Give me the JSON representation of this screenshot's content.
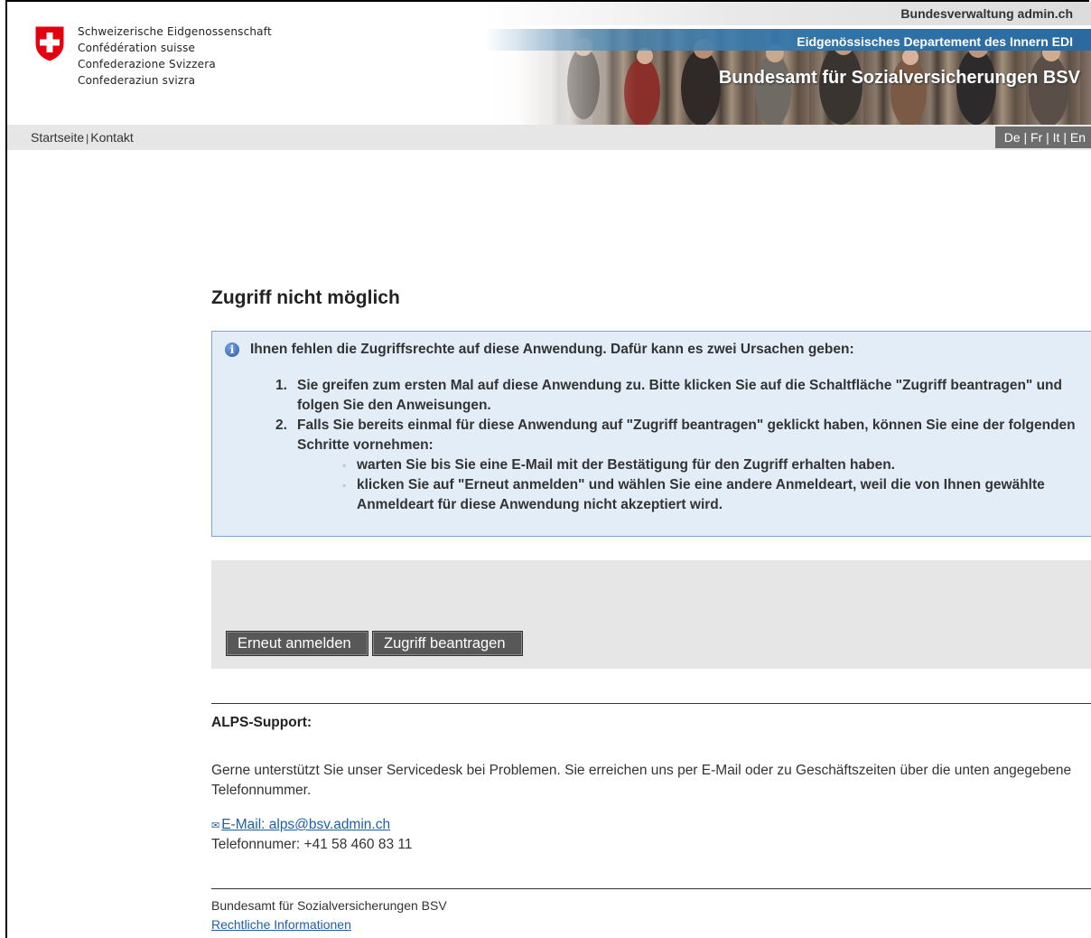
{
  "header": {
    "confederation_names": [
      "Schweizerische Eidgenossenschaft",
      "Confédération suisse",
      "Confederazione Svizzera",
      "Confederaziun svizra"
    ],
    "admin_link": "Bundesverwaltung admin.ch",
    "department": "Eidgenössisches Departement des Innern EDI",
    "office": "Bundesamt für Sozialversicherungen BSV"
  },
  "nav": {
    "home": "Startseite",
    "separator": "|",
    "contact": "Kontakt",
    "languages": [
      "De",
      "Fr",
      "It",
      "En"
    ],
    "lang_separator": "|"
  },
  "main": {
    "title": "Zugriff nicht möglich",
    "info_icon": "info-icon",
    "info_intro": "Ihnen fehlen die Zugriffsrechte auf diese Anwendung. Dafür kann es zwei Ursachen geben:",
    "reasons": [
      {
        "number": "1.",
        "text": "Sie greifen zum ersten Mal auf diese Anwendung zu. Bitte klicken Sie auf die Schaltfläche \"Zugriff beantragen\" und folgen Sie den Anweisungen."
      },
      {
        "number": "2.",
        "text": "Falls Sie bereits einmal für diese Anwendung auf \"Zugriff beantragen\" geklickt haben, können Sie eine der folgenden Schritte vornehmen:",
        "steps": [
          "warten Sie bis Sie eine E-Mail mit der Bestätigung für den Zugriff erhalten haben.",
          "klicken Sie auf \"Erneut anmelden\" und wählen Sie eine andere Anmeldeart, weil die von Ihnen gewählte Anmeldeart für diese Anwendung nicht akzeptiert wird."
        ]
      }
    ],
    "buttons": {
      "relogin": "Erneut anmelden",
      "request_access": "Zugriff beantragen"
    }
  },
  "support": {
    "title": "ALPS-Support:",
    "text": "Gerne unterstützt Sie unser Servicedesk bei Problemen. Sie erreichen uns per E-Mail oder zu Geschäftszeiten über die unten angegebene Telefonnummer.",
    "email_label": "E-Mail: alps@bsv.admin.ch",
    "phone": "Telefonnumer: +41 58 460 83 11"
  },
  "footer": {
    "office": "Bundesamt für Sozialversicherungen BSV",
    "legal_link": "Rechtliche Informationen"
  },
  "colors": {
    "swiss_red": "#e3000f",
    "dept_blue": "#2f73a8",
    "info_bg": "#e3edf8",
    "info_border": "#7fa6c9",
    "button_bg": "#585858",
    "link": "#1f5fa8"
  }
}
